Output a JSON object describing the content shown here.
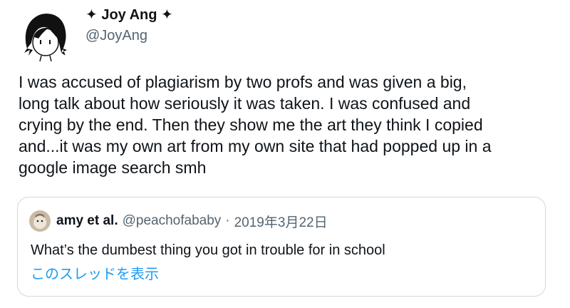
{
  "tweet": {
    "author": {
      "display_name": "✦ Joy Ang ✦",
      "handle": "@JoyAng",
      "avatar_icon": "illustrated-avatar-icon"
    },
    "text": "I was accused of plagiarism by two profs and was given a big,\nlong talk about how seriously it was taken. I was confused and\ncrying by the end. Then they show me the art they think I copied\nand...it was my own art from my own site that had popped up in a\ngoogle image search smh",
    "quoted": {
      "display_name": "amy et al.",
      "handle": "@peachofababy",
      "separator": "·",
      "date": "2019年3月22日",
      "text": "What’s the dumbest thing you got in trouble for in school",
      "thread_link": "このスレッドを表示",
      "avatar_icon": "peach-avatar-icon"
    }
  },
  "colors": {
    "text": "#0f1419",
    "secondary": "#536471",
    "link": "#1d9bf0",
    "border": "#cfd9de"
  }
}
